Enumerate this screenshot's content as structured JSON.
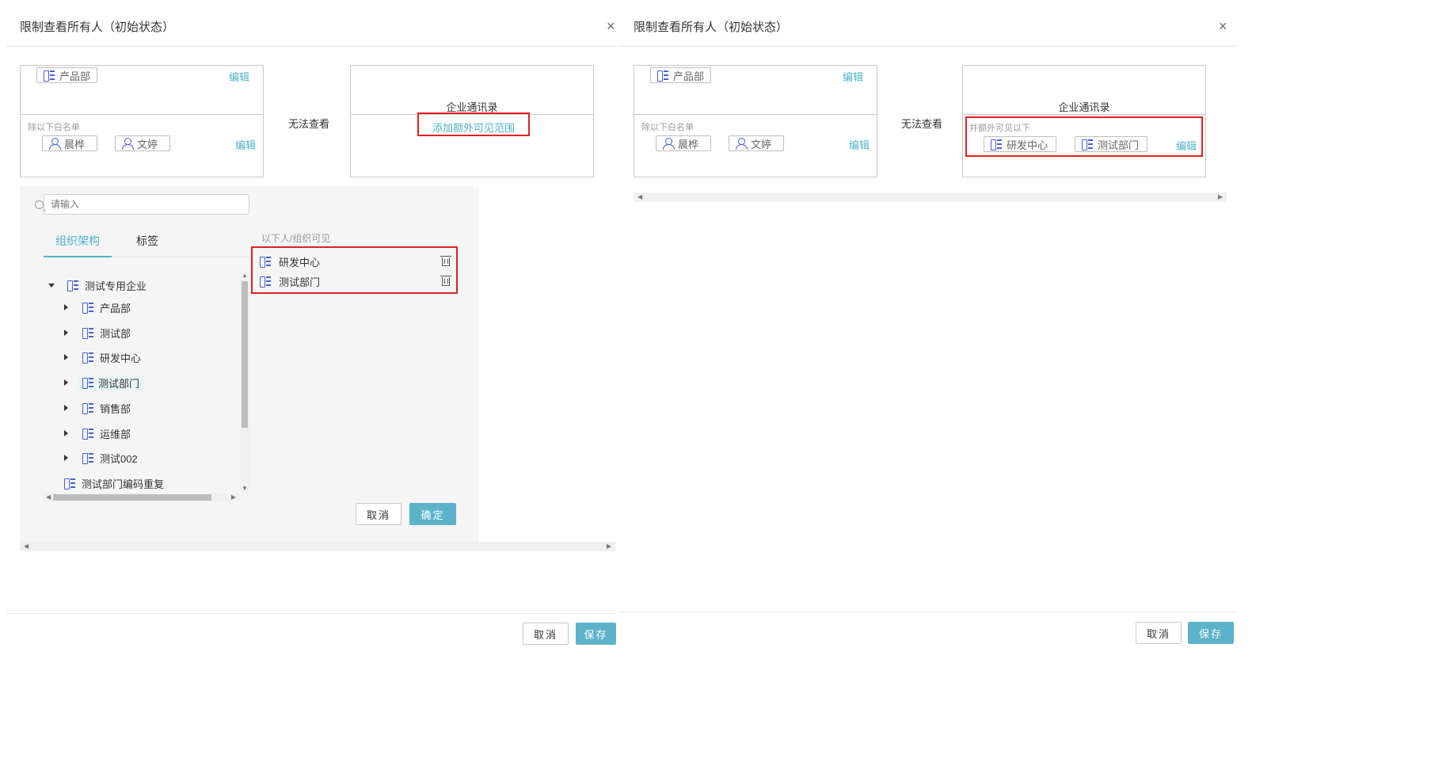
{
  "left_dialog": {
    "title": "限制查看所有人（初始状态）",
    "close_icon": "×",
    "scope_box": {
      "chip": "产品部",
      "edit": "编辑",
      "whitelist_label": "除以下白名单",
      "whitelist_users": [
        "晨桦",
        "文婷"
      ],
      "whitelist_edit": "编辑"
    },
    "cannot_view": "无法查看",
    "directory_box": {
      "title": "企业通讯录",
      "add_link": "添加额外可见范围"
    },
    "picker": {
      "search_placeholder": "请输入",
      "tabs": [
        "组织架构",
        "标签"
      ],
      "tree_root": "测试专用企业",
      "tree_children": [
        "产品部",
        "测试部",
        "研发中心",
        "测试部门",
        "销售部",
        "运维部",
        "测试002"
      ],
      "tree_extra": "测试部门编码重复",
      "visible_label": "以下人/组织可见",
      "selected": [
        "研发中心",
        "测试部门"
      ],
      "cancel": "取消",
      "confirm": "确定"
    },
    "footer": {
      "cancel": "取消",
      "save": "保存"
    }
  },
  "right_dialog": {
    "title": "限制查看所有人（初始状态）",
    "close_icon": "×",
    "scope_box": {
      "chip": "产品部",
      "edit": "编辑",
      "whitelist_label": "除以下白名单",
      "whitelist_users": [
        "晨桦",
        "文婷"
      ],
      "whitelist_edit": "编辑"
    },
    "cannot_view": "无法查看",
    "directory_box": {
      "title": "企业通讯录",
      "extra_label": "并额外可见以下",
      "extra_chips": [
        "研发中心",
        "测试部门"
      ],
      "edit": "编辑"
    },
    "footer": {
      "cancel": "取消",
      "save": "保存"
    }
  },
  "colors": {
    "accent": "#5cb3c9",
    "link": "#4fb3c9",
    "highlight": "#e02020",
    "icon": "#4a5fd0"
  }
}
